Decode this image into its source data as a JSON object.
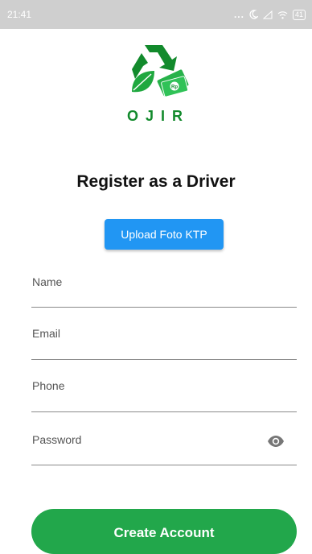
{
  "status_bar": {
    "time": "21:41",
    "battery": "41",
    "icons": [
      "more-dots-icon",
      "moon-icon",
      "signal-icon",
      "wifi-icon",
      "battery-icon"
    ]
  },
  "brand": {
    "name": "OJIR",
    "logo_icon": "recycle-leaf-money-logo",
    "color": "#128a2c"
  },
  "page": {
    "title": "Register as a Driver"
  },
  "upload": {
    "label": "Upload Foto KTP",
    "color": "#2196f3"
  },
  "form": {
    "name_label": "Name",
    "email_label": "Email",
    "phone_label": "Phone",
    "password_label": "Password",
    "password_toggle_icon": "eye-icon"
  },
  "submit": {
    "label": "Create Account",
    "color": "#22a74b"
  }
}
